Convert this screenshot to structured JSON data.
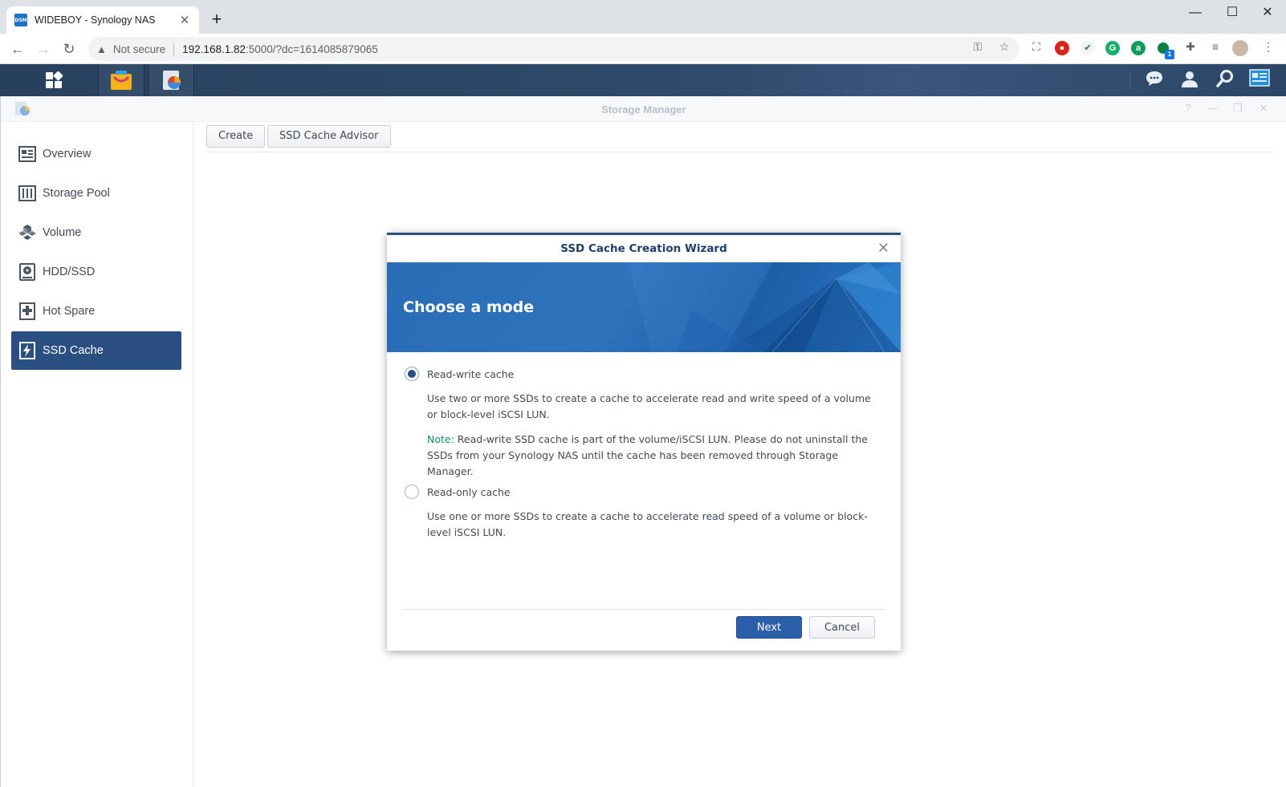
{
  "browser": {
    "tab_title": "WIDEBOY - Synology NAS",
    "favicon_text": "DSM",
    "security_label": "Not secure",
    "url_host": "192.168.1.82",
    "url_rest": ":5000/?dc=1614085879065",
    "extension_badge": "1"
  },
  "dsm": {
    "window_title": "Storage Manager"
  },
  "sidebar": {
    "items": [
      {
        "label": "Overview",
        "icon": "overview-icon"
      },
      {
        "label": "Storage Pool",
        "icon": "storage-pool-icon"
      },
      {
        "label": "Volume",
        "icon": "volume-icon"
      },
      {
        "label": "HDD/SSD",
        "icon": "hdd-icon"
      },
      {
        "label": "Hot Spare",
        "icon": "hot-spare-icon"
      },
      {
        "label": "SSD Cache",
        "icon": "ssd-cache-icon",
        "active": true
      }
    ]
  },
  "toolbar": {
    "create_label": "Create",
    "advisor_label": "SSD Cache Advisor"
  },
  "wizard": {
    "title": "SSD Cache Creation Wizard",
    "step_title": "Choose a mode",
    "options": [
      {
        "label": "Read-write cache",
        "selected": true,
        "description": "Use two or more SSDs to create a cache to accelerate read and write speed of a volume or block-level iSCSI LUN.",
        "note_label": "Note:",
        "note_text": " Read-write SSD cache is part of the volume/iSCSI LUN. Please do not uninstall the SSDs from your Synology NAS until the cache has been removed through Storage Manager."
      },
      {
        "label": "Read-only cache",
        "selected": false,
        "description": "Use one or more SSDs to create a cache to accelerate read speed of a volume or block-level iSCSI LUN."
      }
    ],
    "next_label": "Next",
    "cancel_label": "Cancel"
  },
  "colors": {
    "accent": "#2a5082",
    "taskbar": "#2f4a6b",
    "note": "#0e8a6e"
  }
}
